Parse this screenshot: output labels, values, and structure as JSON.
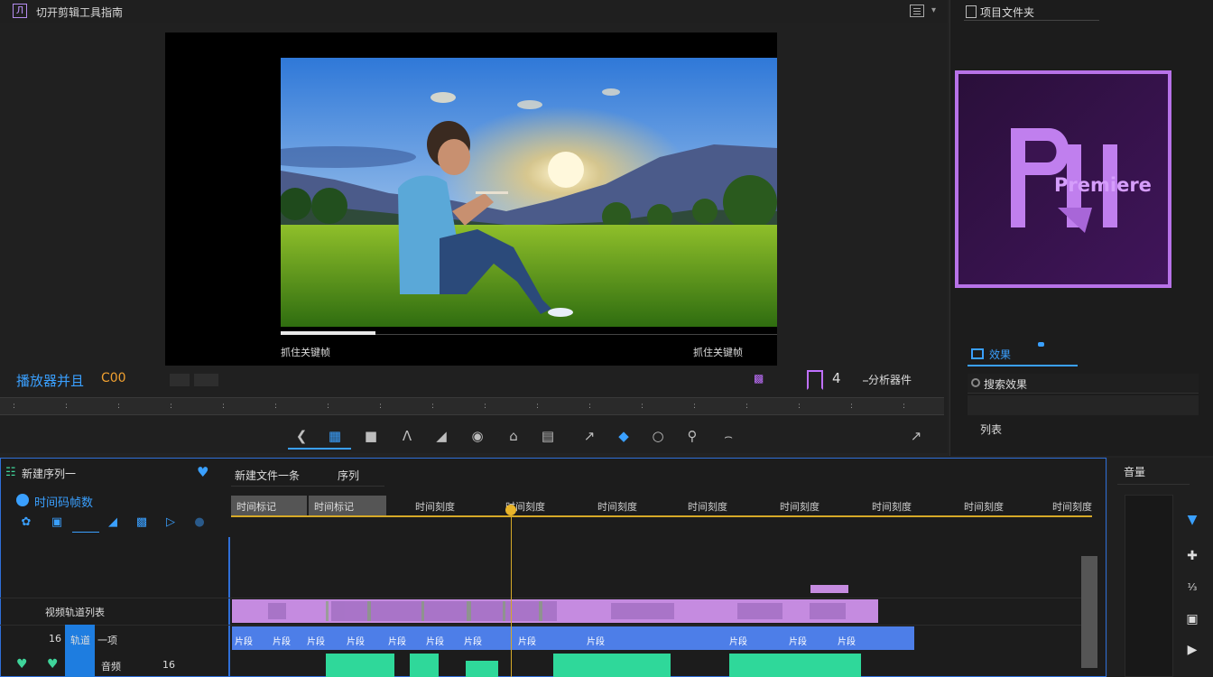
{
  "window": {
    "title": "切开剪辑工具指南",
    "icon": "premiere-small-icon"
  },
  "monitor": {
    "overlay_left_text": "抓住关键帧",
    "overlay_right_text": "抓住关键帧",
    "overlay_progress": 0.19,
    "timecode": "播放器并且",
    "fit_label": "C00",
    "toolbar_num": "4",
    "settings_label": "⎯分析器件",
    "ruler_ticks": [
      ":",
      ":",
      ":",
      ":",
      ":",
      ":",
      ":",
      ":",
      ":",
      ":",
      ":",
      ":",
      ":",
      ":",
      ":",
      ":",
      ":",
      ":"
    ]
  },
  "transport": {
    "buttons": [
      "mark-in-icon",
      "mark-out-icon",
      "step-back-icon",
      "razor-icon",
      "lift-icon",
      "camera-icon",
      "home-icon",
      "film-icon",
      "pen-icon",
      "play-icon",
      "loop-icon",
      "search-icon",
      "more-icon"
    ],
    "active_index": 1
  },
  "right_panel": {
    "header_text": "项目文件夹",
    "logo_text": "Premiere",
    "effects_tab": "效果",
    "search_label": "搜索效果",
    "field_3_label": "列表"
  },
  "timeline": {
    "sequence_name": "新建序列一",
    "tab_1": "新建文件一条",
    "tab_2": "序列",
    "timecode": "时间码帧数",
    "ranges": [
      "时间标记",
      "时间标记"
    ],
    "ticks": [
      "时间刻度",
      "时间刻度",
      "时间刻度",
      "时间刻度",
      "时间刻度",
      "时间刻度",
      "时间刻度",
      "时间刻度"
    ],
    "track_v2_label": "视频轨道列表",
    "track_v1_num": "16",
    "track_v1_name": "轨道",
    "track_v1_tail": "一项",
    "track_a1_name": "音频",
    "track_a1_num": "16",
    "blue_clip_labels": [
      "片段",
      "片段",
      "片段",
      "片段",
      "片段",
      "片段",
      "片段",
      "片段",
      "片段",
      "片段",
      "片段",
      "片段"
    ],
    "playhead_color": "#d6a928"
  },
  "right_bottom": {
    "label": "音量",
    "buttons": [
      "mark-icon",
      "add-icon",
      "fraction-icon",
      "export-icon",
      "play-icon"
    ]
  },
  "colors": {
    "accent_blue": "#3aa0ff",
    "premiere_purple": "#b772e8",
    "video_clip": "#c58be0",
    "clip_blue": "#4d7ee8",
    "audio_clip": "#2fd89a"
  }
}
